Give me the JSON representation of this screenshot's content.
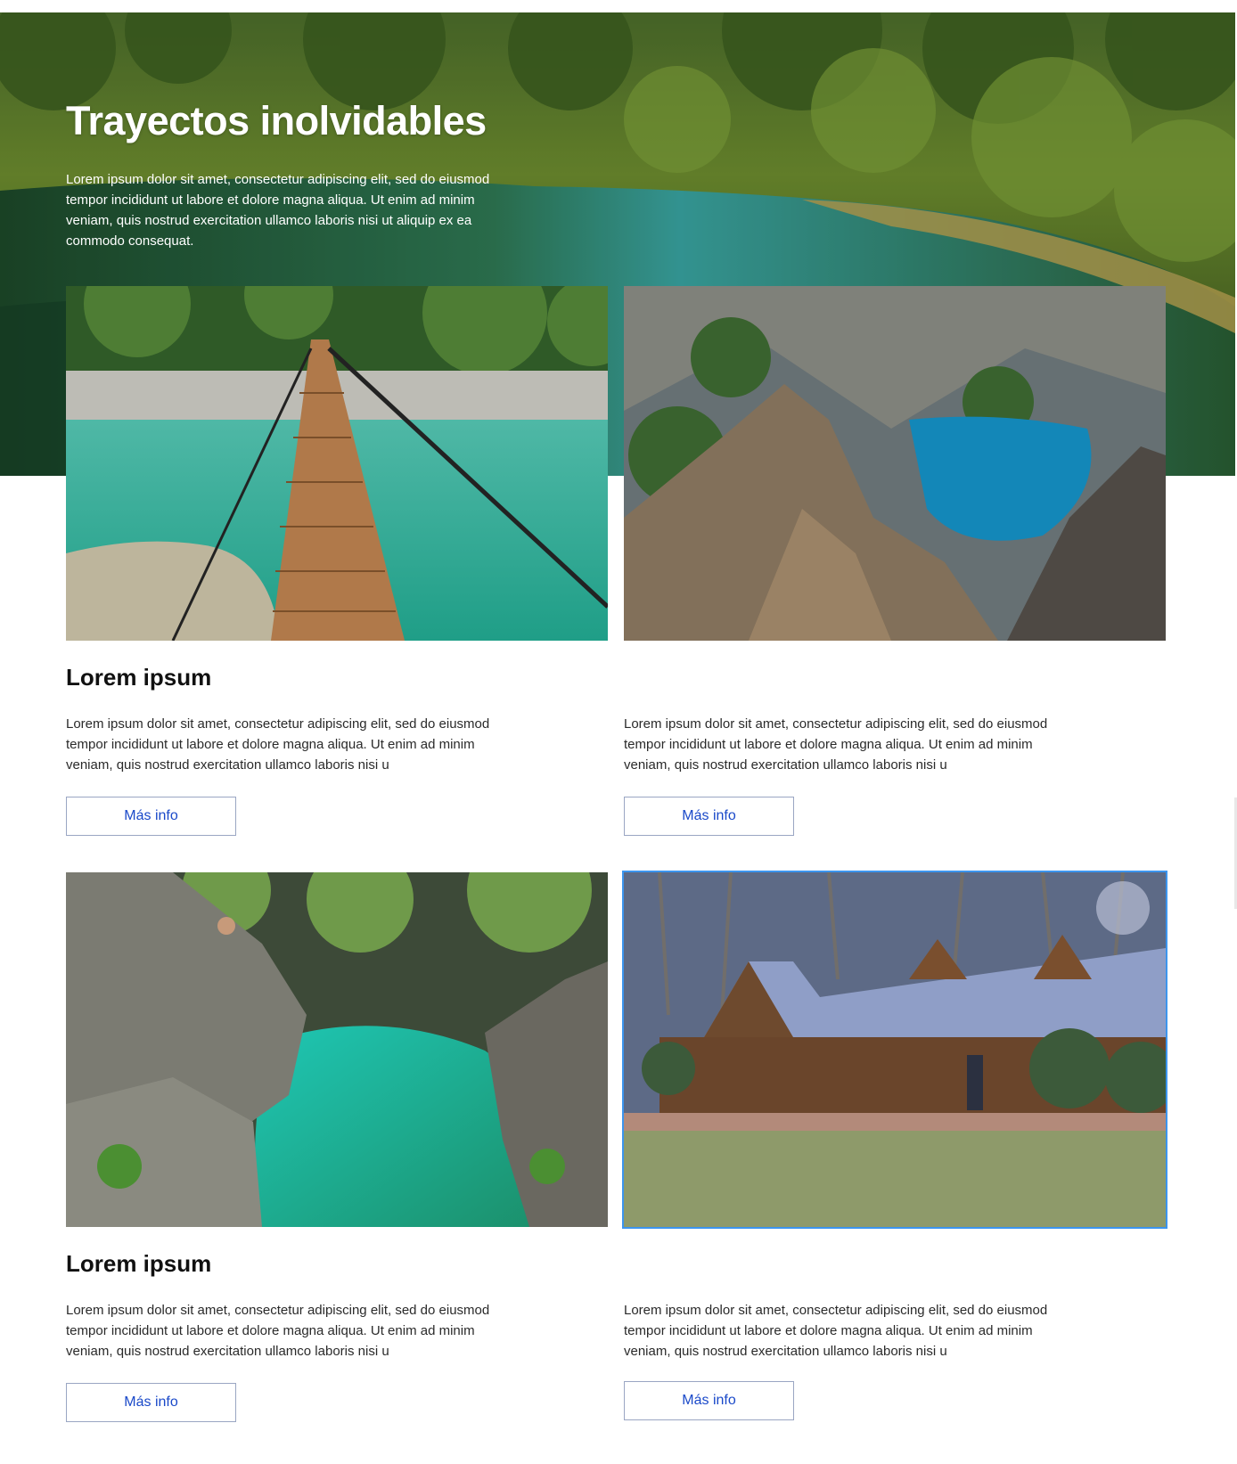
{
  "hero": {
    "title": "Trayectos inolvidables",
    "text": "Lorem ipsum dolor sit amet, consectetur adipiscing elit, sed do eiusmod tempor incididunt ut labore et dolore magna aliqua. Ut enim ad minim veniam, quis nostrud exercitation ullamco laboris nisi ut aliquip ex ea commodo consequat.",
    "image": "lake-forest-landscape"
  },
  "cards": [
    {
      "image": "suspension-bridge-over-turquoise-river",
      "title": "Lorem ipsum",
      "text": "Lorem ipsum dolor sit amet, consectetur adipiscing elit, sed do eiusmod tempor incididunt ut labore et dolore magna aliqua. Ut enim ad minim veniam, quis nostrud exercitation ullamco laboris nisi u",
      "button": "Más info"
    },
    {
      "image": "rocky-peak-with-blue-lagoon",
      "title": "",
      "text": "Lorem ipsum dolor sit amet, consectetur adipiscing elit, sed do eiusmod tempor incididunt ut labore et dolore magna aliqua. Ut enim ad minim veniam, quis nostrud exercitation ullamco laboris nisi u",
      "button": "Más info"
    },
    {
      "image": "rocky-gorge-with-emerald-pool",
      "title": "Lorem ipsum",
      "text": "Lorem ipsum dolor sit amet, consectetur adipiscing elit, sed do eiusmod tempor incididunt ut labore et dolore magna aliqua. Ut enim ad minim veniam, quis nostrud exercitation ullamco laboris nisi u",
      "button": "Más info"
    },
    {
      "image": "log-cabin-lodge-in-forest",
      "title": "",
      "text": "Lorem ipsum dolor sit amet, consectetur adipiscing elit, sed do eiusmod tempor incididunt ut labore et dolore magna aliqua. Ut enim ad minim veniam, quis nostrud exercitation ullamco laboris nisi u",
      "button": "Más info"
    }
  ],
  "colors": {
    "button_text": "#1a49c9",
    "button_border": "#9aa6c3",
    "selection_outline": "#3c95ee"
  }
}
